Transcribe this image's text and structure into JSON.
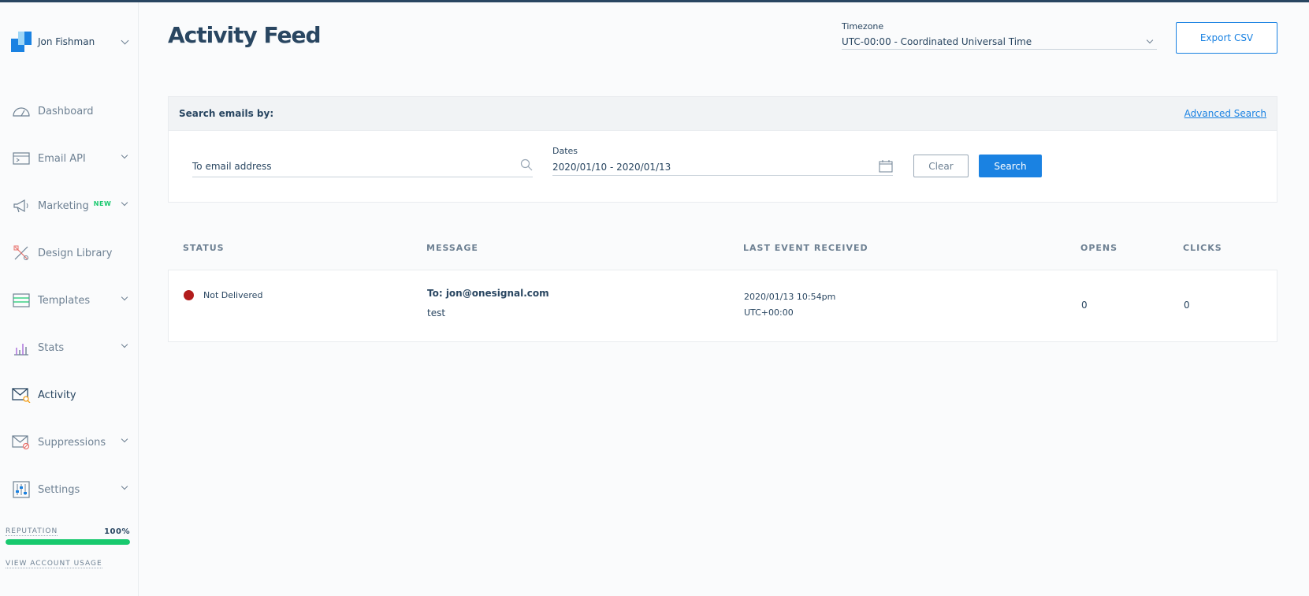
{
  "account": {
    "name": "Jon Fishman"
  },
  "sidebar": {
    "items": [
      {
        "label": "Dashboard"
      },
      {
        "label": "Email API"
      },
      {
        "label": "Marketing",
        "badge": "NEW"
      },
      {
        "label": "Design Library"
      },
      {
        "label": "Templates"
      },
      {
        "label": "Stats"
      },
      {
        "label": "Activity"
      },
      {
        "label": "Suppressions"
      },
      {
        "label": "Settings"
      }
    ],
    "reputation_label": "REPUTATION",
    "reputation_value": "100%",
    "reputation_level": 1.0,
    "usage_link": "VIEW ACCOUNT USAGE"
  },
  "page": {
    "title": "Activity Feed"
  },
  "timezone": {
    "label": "Timezone",
    "value": "UTC-00:00 - Coordinated Universal Time"
  },
  "export_label": "Export CSV",
  "search": {
    "heading": "Search emails by:",
    "advanced": "Advanced Search",
    "email_placeholder": "To email address",
    "dates_label": "Dates",
    "dates_value": "2020/01/10 - 2020/01/13",
    "clear": "Clear",
    "submit": "Search"
  },
  "table": {
    "headers": {
      "status": "STATUS",
      "message": "MESSAGE",
      "last_event": "LAST EVENT RECEIVED",
      "opens": "OPENS",
      "clicks": "CLICKS"
    },
    "rows": [
      {
        "status": "Not Delivered",
        "to": "To: jon@onesignal.com",
        "subject": "test",
        "event_date": "2020/01/13 10:54pm",
        "event_tz": "UTC+00:00",
        "opens": "0",
        "clicks": "0"
      }
    ]
  },
  "colors": {
    "brand_blue": "#1a82e2",
    "navy": "#294661",
    "status_red": "#b21c1c",
    "reputation_green": "#18c96e"
  }
}
